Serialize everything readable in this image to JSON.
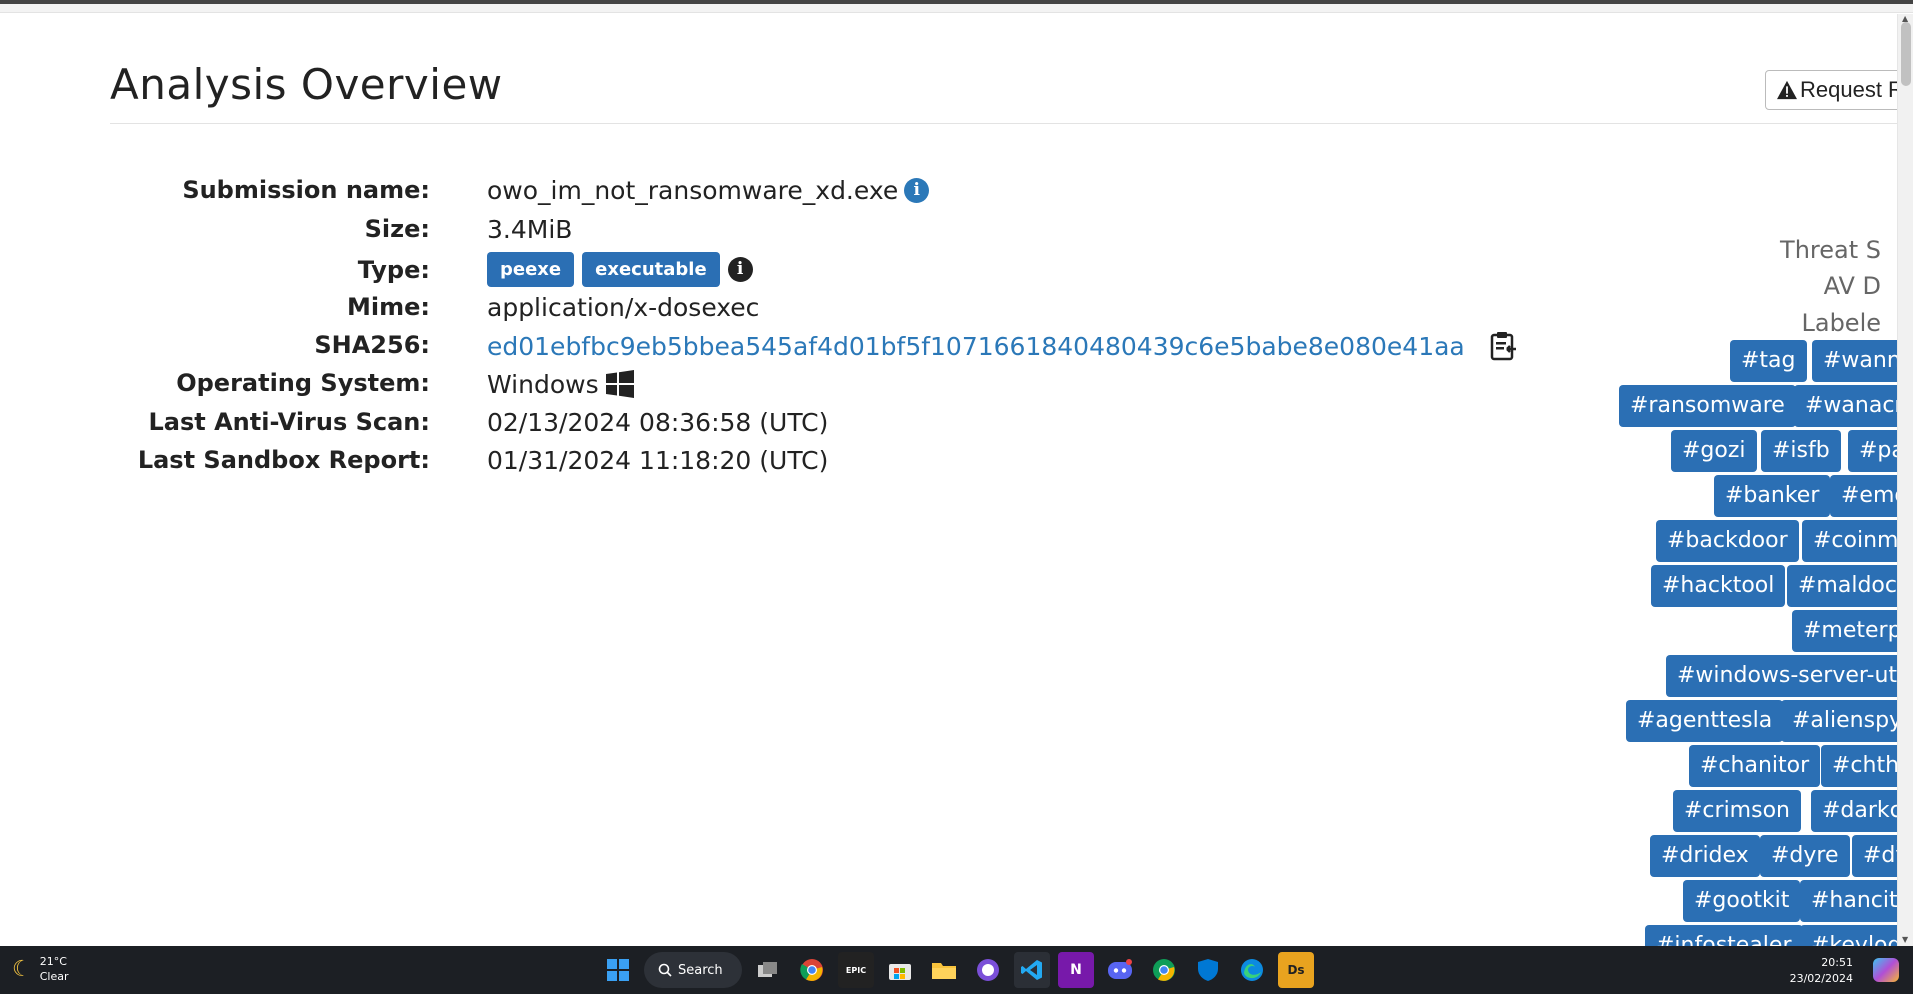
{
  "page": {
    "title": "Analysis Overview",
    "request_button_label": "Request R"
  },
  "details": {
    "submission_name_label": "Submission name:",
    "submission_name_value": "owo_im_not_ransomware_xd.exe",
    "size_label": "Size:",
    "size_value": "3.4MiB",
    "type_label": "Type:",
    "type_badges": [
      "peexe",
      "executable"
    ],
    "mime_label": "Mime:",
    "mime_value": "application/x-dosexec",
    "sha256_label": "SHA256:",
    "sha256_value": "ed01ebfbc9eb5bbea545af4d01bf5f1071661840480439c6e5babe8e080e41aa",
    "os_label": "Operating System:",
    "os_value": "Windows",
    "last_av_scan_label": "Last Anti-Virus Scan:",
    "last_av_scan_value": "02/13/2024 08:36:58 (UTC)",
    "last_sandbox_label": "Last Sandbox Report:",
    "last_sandbox_value": "01/31/2024 11:18:20 (UTC)"
  },
  "right_panel": {
    "threat_label": "Threat S",
    "av_label": "AV D",
    "labeled_label": "Labele",
    "tags": [
      "#tag",
      "#wanna",
      "#ransomware",
      "#wanacr",
      "#gozi",
      "#isfb",
      "#pa",
      "#banker",
      "#emo",
      "#backdoor",
      "#coinmi",
      "#hacktool",
      "#maldoc",
      "#meterp",
      "#windows-server-util",
      "#agenttesla",
      "#alienspy",
      "#chanitor",
      "#chth",
      "#crimson",
      "#darkco",
      "#dridex",
      "#dyre",
      "#dy",
      "#gootkit",
      "#hancit",
      "#infostealer",
      "#keylog"
    ]
  },
  "taskbar": {
    "temperature": "21°C",
    "condition": "Clear",
    "search_label": "Search",
    "time": "20:51",
    "date": "23/02/2024"
  }
}
